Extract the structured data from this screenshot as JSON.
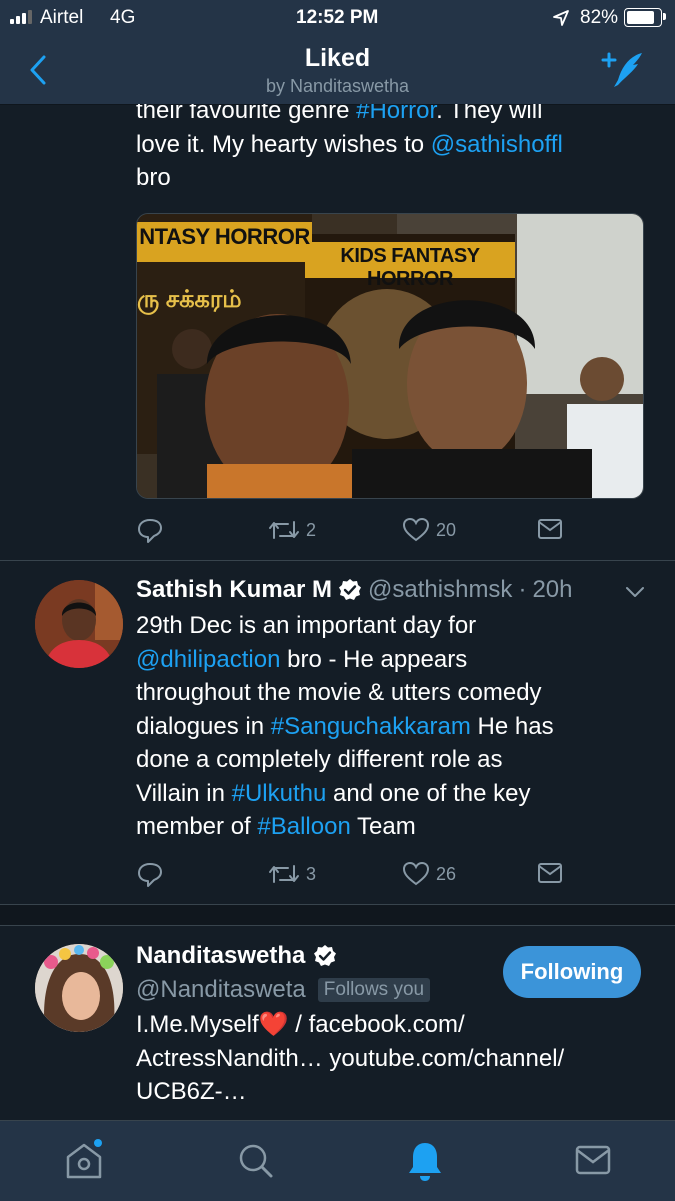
{
  "status_bar": {
    "carrier": "Airtel",
    "network": "4G",
    "time": "12:52 PM",
    "battery": "82%"
  },
  "nav": {
    "title": "Liked",
    "subtitle": "by Nanditaswetha",
    "compose_icon": "compose-tweet-icon",
    "back_icon": "back-chevron-icon"
  },
  "tweet1": {
    "text_line1_a": "their favourite genre ",
    "text_line1_hashtag": "#Horror",
    "text_line1_b": ". They will",
    "text_line2_a": "love it. My hearty wishes to ",
    "text_line2_mention": "@sathishoffl",
    "text_line3": "bro",
    "image": {
      "banner_left": "NTASY HORROR",
      "banner_right": "KIDS FANTASY HORROR",
      "tamil_title": "ரு சக்கரம்"
    },
    "retweets": "2",
    "likes": "20"
  },
  "tweet2": {
    "name": "Sathish Kumar M",
    "handle": "@sathishmsk",
    "dot": "·",
    "time": "20h",
    "lines": [
      {
        "parts": [
          {
            "t": "29th Dec is an important day for",
            "k": "text"
          }
        ]
      },
      {
        "parts": [
          {
            "t": "@dhilipaction",
            "k": "link"
          },
          {
            "t": " bro - He appears",
            "k": "text"
          }
        ]
      },
      {
        "parts": [
          {
            "t": "throughout the movie & utters comedy",
            "k": "text"
          }
        ]
      },
      {
        "parts": [
          {
            "t": "dialogues in ",
            "k": "text"
          },
          {
            "t": "#Sanguchakkaram",
            "k": "link"
          },
          {
            "t": " He has",
            "k": "text"
          }
        ]
      },
      {
        "parts": [
          {
            "t": "done a completely different role as",
            "k": "text"
          }
        ]
      },
      {
        "parts": [
          {
            "t": "Villain in ",
            "k": "text"
          },
          {
            "t": "#Ulkuthu",
            "k": "link"
          },
          {
            "t": " and one of the key",
            "k": "text"
          }
        ]
      },
      {
        "parts": [
          {
            "t": "member of ",
            "k": "text"
          },
          {
            "t": "#Balloon",
            "k": "link"
          },
          {
            "t": " Team",
            "k": "text"
          }
        ]
      }
    ],
    "retweets": "3",
    "likes": "26"
  },
  "profile": {
    "name": "Nanditaswetha",
    "handle": "@Nanditasweta",
    "follows_you": "Follows you",
    "follow_button": "Following",
    "bio_line1_a": "I.Me.Myself",
    "bio_line1_heart": "❤️",
    "bio_line1_b": " / facebook.com/",
    "bio_line2": "ActressNandith… youtube.com/channel/",
    "bio_line3": "UCB6Z-…"
  },
  "tabbar": {
    "tabs": [
      {
        "name": "home",
        "icon": "home-icon",
        "active": false,
        "dot": true
      },
      {
        "name": "search",
        "icon": "search-icon",
        "active": false
      },
      {
        "name": "notifications",
        "icon": "bell-icon",
        "active": true
      },
      {
        "name": "messages",
        "icon": "mail-icon",
        "active": false
      }
    ]
  },
  "colors": {
    "background": "#141d26",
    "header": "#243447",
    "accent": "#1da1f2",
    "muted": "#8899a6"
  }
}
